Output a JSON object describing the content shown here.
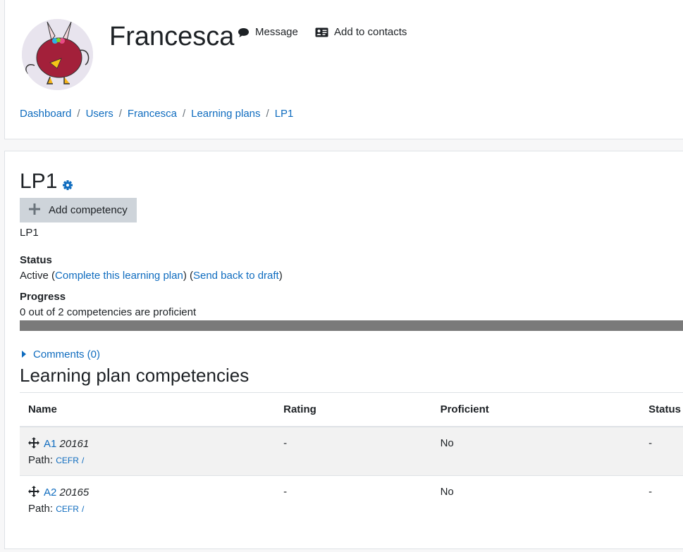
{
  "header": {
    "user_name": "Francesca",
    "message_label": "Message",
    "contacts_label": "Add to contacts"
  },
  "breadcrumb": [
    "Dashboard",
    "Users",
    "Francesca",
    "Learning plans",
    "LP1"
  ],
  "plan": {
    "title": "LP1",
    "add_competency_label": "Add competency",
    "description": "LP1",
    "status_label": "Status",
    "status_value": "Active",
    "complete_link": "Complete this learning plan",
    "draft_link": "Send back to draft",
    "progress_label": "Progress",
    "progress_text": "0 out of 2 competencies are proficient",
    "progress_fraction": 0,
    "comments_label": "Comments (0)"
  },
  "competencies": {
    "section_title": "Learning plan competencies",
    "columns": [
      "Name",
      "Rating",
      "Proficient",
      "Status"
    ],
    "rows": [
      {
        "name": "A1",
        "idnumber": "20161",
        "path_label": "Path:",
        "path_link": "CEFR",
        "path_sep": "/",
        "rating": "-",
        "proficient": "No",
        "status": "-"
      },
      {
        "name": "A2",
        "idnumber": "20165",
        "path_label": "Path:",
        "path_link": "CEFR",
        "path_sep": "/",
        "rating": "-",
        "proficient": "No",
        "status": "-"
      }
    ]
  },
  "colors": {
    "link": "#0f6cbf",
    "progress_track": "#7a7a7a",
    "button_bg": "#ced4da"
  },
  "icons": [
    "message-icon",
    "contact-card-icon",
    "gear-icon",
    "plus-icon",
    "caret-right-icon",
    "move-icon"
  ]
}
